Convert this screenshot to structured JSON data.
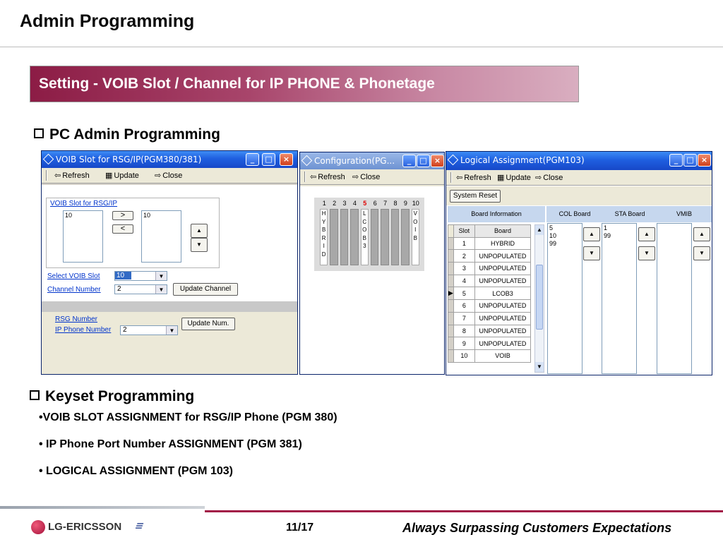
{
  "page": {
    "title": "Admin Programming",
    "banner": "Setting - VOIB Slot /  Channel for IP PHONE & Phonetage",
    "section1": "PC Admin Programming",
    "section2": "Keyset Programming",
    "bullets": [
      "•VOIB SLOT ASSIGNMENT for RSG/IP Phone   (PGM 380)",
      "• IP Phone Port Number ASSIGNMENT   (PGM 381)",
      "• LOGICAL ASSIGNMENT   (PGM 103)"
    ],
    "footer_page": "11/17",
    "footer_slogan": "Always Surpassing Customers Expectations",
    "logo_text": "LG-ERICSSON"
  },
  "win1": {
    "title": "VOIB Slot for RSG/IP(PGM380/381)",
    "toolbar": {
      "refresh": "Refresh",
      "update": "Update",
      "close": "Close"
    },
    "group_label": "VOIB Slot for RSG/IP",
    "left_list": [
      "10"
    ],
    "right_list": [
      "10"
    ],
    "btn_add": ">",
    "btn_remove": "<",
    "select_slot_label": "Select VOIB Slot",
    "select_slot_value": "10",
    "channel_label": "Channel Number",
    "channel_value": "2",
    "update_channel": "Update Channel",
    "rsg_label": "RSG Number",
    "ipphone_label": "IP Phone Number",
    "ipphone_value": "2",
    "update_num": "Update Num."
  },
  "win2": {
    "title": "Configuration(PG...",
    "toolbar": {
      "refresh": "Refresh",
      "close": "Close"
    },
    "slot_numbers": [
      "1",
      "2",
      "3",
      "4",
      "5",
      "6",
      "7",
      "8",
      "9",
      "10"
    ],
    "highlight_slot": "5",
    "slot_labels": {
      "s1": [
        "H",
        "Y",
        "B",
        "R",
        "I",
        "D"
      ],
      "s5": [
        "L",
        "C",
        "O",
        "B",
        "3"
      ],
      "s10": [
        "V",
        "O",
        "I",
        "B"
      ]
    }
  },
  "win3": {
    "title": "Logical Assignment(PGM103)",
    "toolbar": {
      "refresh": "Refresh",
      "update": "Update",
      "close": "Close"
    },
    "system_reset": "System Reset",
    "headers": {
      "board_info": "Board Information",
      "col_board": "COL Board",
      "sta_board": "STA Board",
      "vmib": "VMIB"
    },
    "table_columns": [
      "Slot",
      "Board"
    ],
    "rows": [
      [
        "1",
        "HYBRID"
      ],
      [
        "2",
        "UNPOPULATED"
      ],
      [
        "3",
        "UNPOPULATED"
      ],
      [
        "4",
        "UNPOPULATED"
      ],
      [
        "5",
        "LCOB3"
      ],
      [
        "6",
        "UNPOPULATED"
      ],
      [
        "7",
        "UNPOPULATED"
      ],
      [
        "8",
        "UNPOPULATED"
      ],
      [
        "9",
        "UNPOPULATED"
      ],
      [
        "10",
        "VOIB"
      ]
    ],
    "col_list": [
      "5",
      "10",
      "99"
    ],
    "sta_list": [
      "1",
      "99"
    ]
  }
}
